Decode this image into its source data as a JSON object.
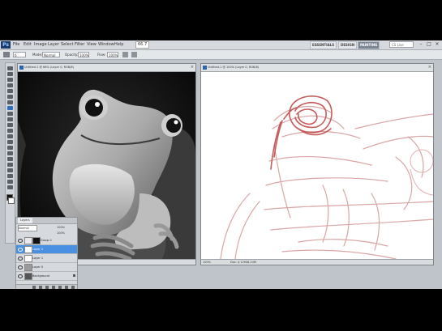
{
  "menubar": {
    "logo": "Ps",
    "menus": [
      "File",
      "Edit",
      "Image",
      "Layer",
      "Select",
      "Filter",
      "View",
      "Window",
      "Help"
    ],
    "zoom": "66.7",
    "workspaces": [
      "ESSENTIALS",
      "DESIGN",
      "PAINTING"
    ],
    "search_label": "CS Live",
    "window_buttons": [
      "–",
      "□",
      "×"
    ]
  },
  "options_bar": {
    "brush_size": "6",
    "mode_label": "Mode:",
    "mode_value": "Normal",
    "opacity_label": "Opacity:",
    "opacity_value": "100%",
    "flow_label": "Flow:",
    "flow_value": "100%"
  },
  "doc1": {
    "title": "Untitled-1 @ 66% (Layer 0, RGB/8)",
    "zoom": "66.67%",
    "doc_info": "Doc: 4.12M/8.24M"
  },
  "doc2": {
    "title": "Untitled-1 @ 100% (Layer 0, RGB/8)",
    "zoom": "100%",
    "doc_info": "Doc: 4.12M/8.24M"
  },
  "layers_panel": {
    "tab": "Layers",
    "blend_mode": "Normal",
    "opacity": "100%",
    "fill": "100%",
    "layers": [
      {
        "name": "Group 1",
        "selected": false
      },
      {
        "name": "Layer 2",
        "selected": true
      },
      {
        "name": "Layer 1",
        "selected": false
      },
      {
        "name": "Layer 0",
        "selected": false
      },
      {
        "name": "Background",
        "selected": false
      }
    ]
  },
  "colors": {
    "sketch": "#c65b5b",
    "accent": "#4a90e2"
  }
}
